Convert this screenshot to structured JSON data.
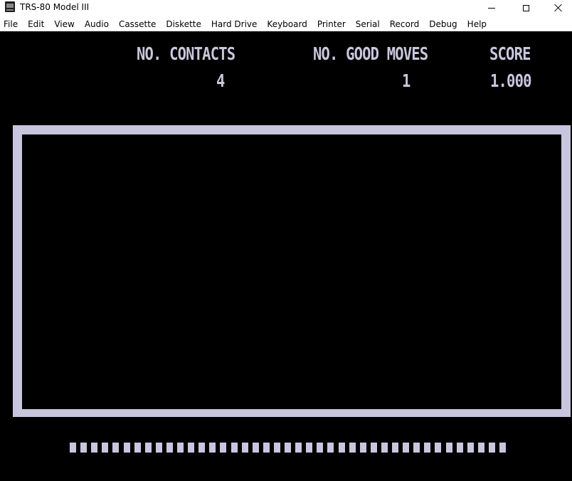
{
  "window": {
    "title": "TRS-80 Model III"
  },
  "menu": [
    "File",
    "Edit",
    "View",
    "Audio",
    "Cassette",
    "Diskette",
    "Hard Drive",
    "Keyboard",
    "Printer",
    "Serial",
    "Record",
    "Debug",
    "Help"
  ],
  "game": {
    "headers": {
      "contacts": "NO. CONTACTS",
      "good_moves": "NO. GOOD MOVES",
      "score": "SCORE"
    },
    "values": {
      "contacts": "4",
      "good_moves": "1",
      "score": "1.000"
    },
    "progress_segments": 41
  },
  "colors": {
    "screen_bg": "#000000",
    "phosphor": "#c8c6df"
  }
}
